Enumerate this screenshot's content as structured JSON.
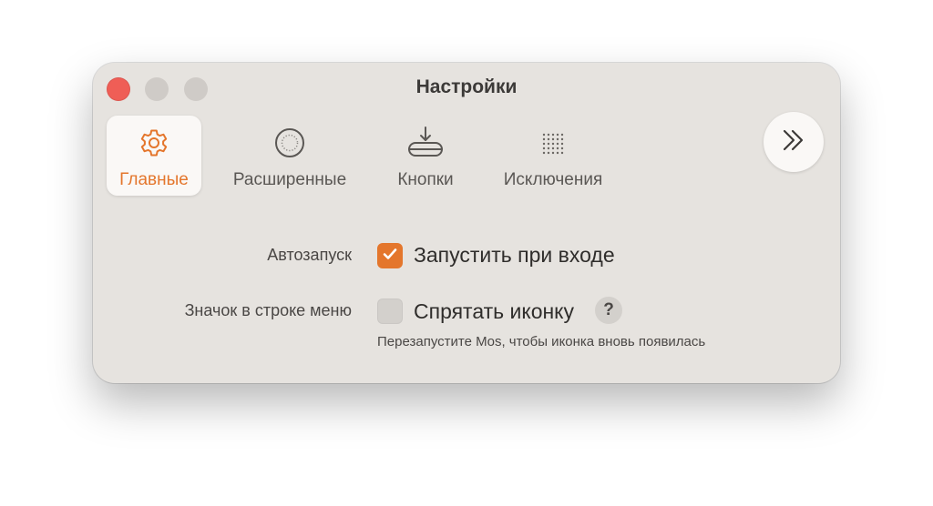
{
  "window": {
    "title": "Настройки"
  },
  "toolbar": {
    "tabs": [
      {
        "label": "Главные",
        "icon": "gear-icon",
        "active": true
      },
      {
        "label": "Расширенные",
        "icon": "circle-dots-icon",
        "active": false
      },
      {
        "label": "Кнопки",
        "icon": "tray-download-icon",
        "active": false
      },
      {
        "label": "Исключения",
        "icon": "dot-grid-icon",
        "active": false
      }
    ],
    "more_icon": "double-chevron-right-icon"
  },
  "settings": {
    "autostart": {
      "label": "Автозапуск",
      "option_label": "Запустить при входе",
      "checked": true
    },
    "menubar_icon": {
      "label": "Значок в строке меню",
      "option_label": "Спрятать иконку",
      "checked": false,
      "help_label": "?",
      "note": "Перезапустите Mos, чтобы иконка вновь появилась"
    }
  },
  "colors": {
    "accent": "#e4762c",
    "window_bg": "#e6e3df",
    "close_button": "#ef5e56"
  }
}
